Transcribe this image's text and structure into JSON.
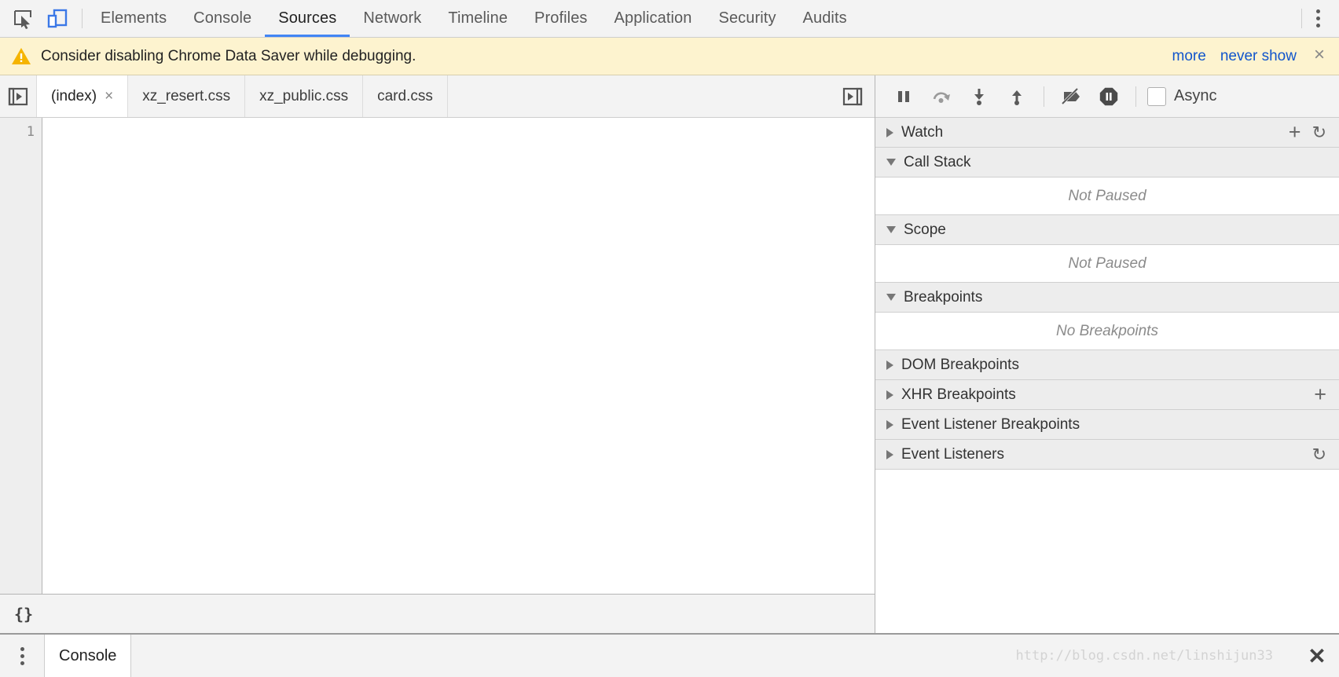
{
  "topbar": {
    "inspect_icon": "inspect-element-icon",
    "device_icon": "device-toolbar-icon",
    "tabs": [
      {
        "label": "Elements",
        "active": false
      },
      {
        "label": "Console",
        "active": false
      },
      {
        "label": "Sources",
        "active": true
      },
      {
        "label": "Network",
        "active": false
      },
      {
        "label": "Timeline",
        "active": false
      },
      {
        "label": "Profiles",
        "active": false
      },
      {
        "label": "Application",
        "active": false
      },
      {
        "label": "Security",
        "active": false
      },
      {
        "label": "Audits",
        "active": false
      }
    ],
    "menu_icon": "more-options-icon",
    "active_underline_color": "#4285f4"
  },
  "banner": {
    "icon": "warning-triangle-icon",
    "message": "Consider disabling Chrome Data Saver while debugging.",
    "more_label": "more",
    "never_show_label": "never show",
    "close_label": "×",
    "background_color": "#fdf3cf",
    "link_color": "#1155cc",
    "warning_color": "#f5b400"
  },
  "filetabs": {
    "navigator_toggle_icon": "show-navigator-icon",
    "panel_toggle_icon": "show-debugger-icon",
    "tabs": [
      {
        "label": "(index)",
        "active": true,
        "close": "×"
      },
      {
        "label": "xz_resert.css",
        "active": false
      },
      {
        "label": "xz_public.css",
        "active": false
      },
      {
        "label": "card.css",
        "active": false
      }
    ]
  },
  "editor": {
    "line_numbers": [
      "1"
    ],
    "content": ""
  },
  "statusbar": {
    "pretty_print_label": "{}"
  },
  "debugger": {
    "buttons": [
      {
        "name": "pause-script-button",
        "title": "pause"
      },
      {
        "name": "step-over-button",
        "title": "step over"
      },
      {
        "name": "step-into-button",
        "title": "step into"
      },
      {
        "name": "step-out-button",
        "title": "step out"
      },
      {
        "name": "deactivate-breakpoints-button",
        "title": "deactivate breakpoints"
      },
      {
        "name": "pause-on-exceptions-button",
        "title": "pause on exceptions"
      }
    ],
    "async_label": "Async",
    "async_checked": false,
    "sections": [
      {
        "title": "Watch",
        "expanded": false,
        "body": null,
        "actions": [
          "plus",
          "refresh"
        ]
      },
      {
        "title": "Call Stack",
        "expanded": true,
        "body": "Not Paused",
        "actions": []
      },
      {
        "title": "Scope",
        "expanded": true,
        "body": "Not Paused",
        "actions": []
      },
      {
        "title": "Breakpoints",
        "expanded": true,
        "body": "No Breakpoints",
        "actions": []
      },
      {
        "title": "DOM Breakpoints",
        "expanded": false,
        "body": null,
        "actions": []
      },
      {
        "title": "XHR Breakpoints",
        "expanded": false,
        "body": null,
        "actions": [
          "plus"
        ]
      },
      {
        "title": "Event Listener Breakpoints",
        "expanded": false,
        "body": null,
        "actions": []
      },
      {
        "title": "Event Listeners",
        "expanded": false,
        "body": null,
        "actions": [
          "refresh"
        ]
      }
    ],
    "plus_glyph": "+",
    "refresh_glyph": "↻"
  },
  "drawer": {
    "menu_icon": "drawer-options-icon",
    "tab_label": "Console",
    "close_label": "✕",
    "watermark": "http://blog.csdn.net/linshijun33"
  }
}
